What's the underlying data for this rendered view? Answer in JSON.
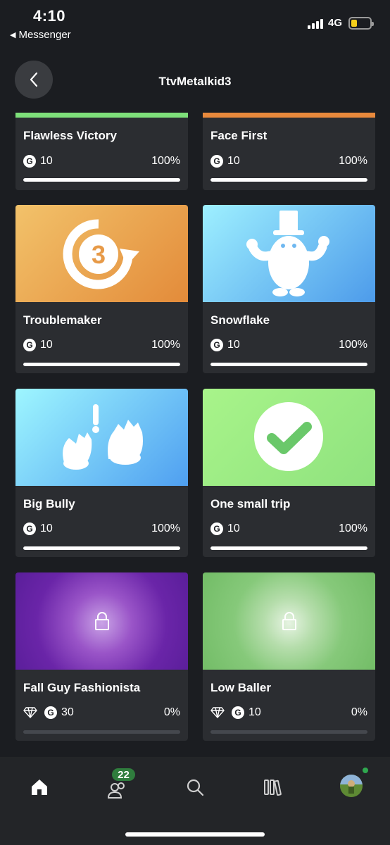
{
  "status_bar": {
    "time": "4:10",
    "back_app": "Messenger",
    "network": "4G"
  },
  "header": {
    "title": "TtvMetalkid3"
  },
  "achievements": [
    {
      "name": "Flawless Victory",
      "gamerscore": "10",
      "percent": "100%",
      "progress": 1.0,
      "stripe_color": "#7ee07a"
    },
    {
      "name": "Face First",
      "gamerscore": "10",
      "percent": "100%",
      "progress": 1.0,
      "stripe_color": "#e8893c"
    },
    {
      "name": "Troublemaker",
      "gamerscore": "10",
      "percent": "100%",
      "progress": 1.0,
      "art_icon": "restart-3-icon",
      "art_colors": [
        "#f2c26a",
        "#e38b3a"
      ]
    },
    {
      "name": "Snowflake",
      "gamerscore": "10",
      "percent": "100%",
      "progress": 1.0,
      "art_icon": "fall-guy-tophat-icon",
      "art_colors": [
        "#9ef0ff",
        "#4d9bea"
      ]
    },
    {
      "name": "Big Bully",
      "gamerscore": "10",
      "percent": "100%",
      "progress": 1.0,
      "art_icon": "grabbing-hands-icon",
      "art_colors": [
        "#9ef6ff",
        "#4f9ff0"
      ]
    },
    {
      "name": "One small trip",
      "gamerscore": "10",
      "percent": "100%",
      "progress": 1.0,
      "art_icon": "checkmark-icon",
      "art_colors": [
        "#a8f48a",
        "#8fe27e"
      ]
    },
    {
      "name": "Fall Guy Fashionista",
      "gamerscore": "30",
      "percent": "0%",
      "progress": 0.0,
      "locked": true,
      "rare": true,
      "art_colors": [
        "#7a2bb8",
        "#5a1e9a"
      ]
    },
    {
      "name": "Low Baller",
      "gamerscore": "10",
      "percent": "0%",
      "progress": 0.0,
      "locked": true,
      "rare": true,
      "art_colors": [
        "#7bc86f",
        "#6ab85e"
      ]
    }
  ],
  "bottom_nav": {
    "items": [
      "home-icon",
      "friends-icon",
      "search-icon",
      "library-icon",
      "profile-avatar"
    ],
    "friends_badge": "22"
  }
}
